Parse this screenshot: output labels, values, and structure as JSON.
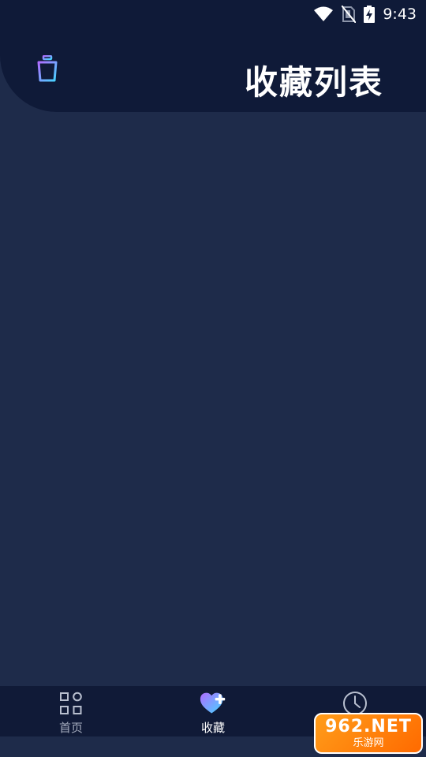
{
  "status_bar": {
    "time": "9:43",
    "icons": [
      "wifi-icon",
      "no-sim-icon",
      "battery-charging-icon"
    ]
  },
  "header": {
    "title": "收藏列表",
    "left_icon": "trash-icon"
  },
  "tabbar": {
    "tabs": [
      {
        "label": "首页",
        "icon": "grid-icon",
        "active": false
      },
      {
        "label": "收藏",
        "icon": "heart-plus-icon",
        "active": true
      },
      {
        "label": "",
        "icon": "clock-icon",
        "active": false
      }
    ]
  },
  "watermark": {
    "main": "962.NET",
    "sub": "乐游网"
  },
  "colors": {
    "background": "#1e2b4a",
    "header": "#0f1a38",
    "tabbar": "#101a37",
    "accent_gradient_start": "#b06cff",
    "accent_gradient_end": "#45d4ff"
  }
}
